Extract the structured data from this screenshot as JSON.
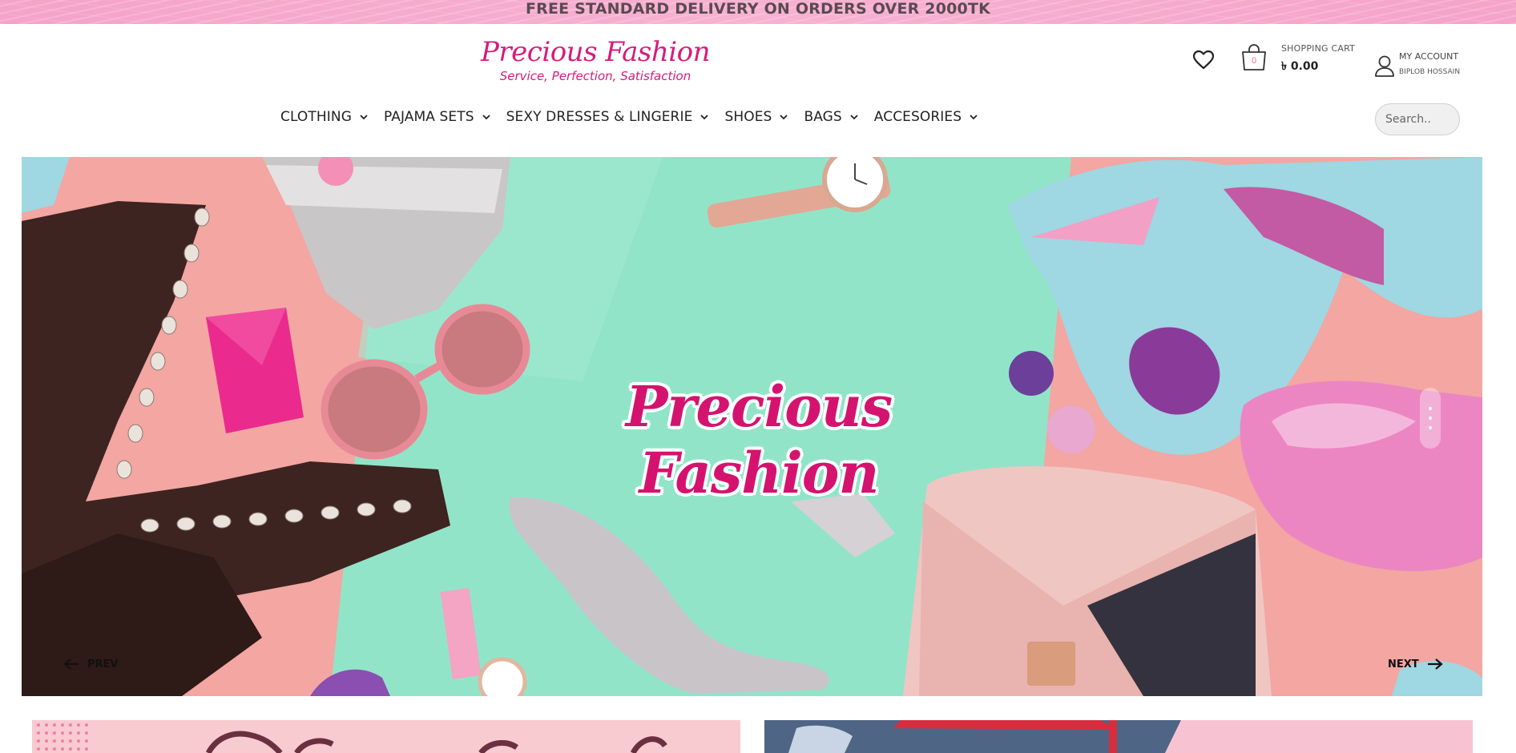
{
  "announcement": "FREE STANDARD DELIVERY ON ORDERS OVER 2000TK",
  "logo": {
    "title": "Precious Fashion",
    "tagline": "Service, Perfection, Satisfaction"
  },
  "header": {
    "wishlist_icon": "heart-icon",
    "cart": {
      "count": "0",
      "label": "SHOPPING CART",
      "amount": "৳ 0.00"
    },
    "account": {
      "label": "MY ACCOUNT",
      "user": "BIPLOB HOSSAIN"
    }
  },
  "nav": {
    "items": [
      {
        "label": "CLOTHING"
      },
      {
        "label": "PAJAMA SETS"
      },
      {
        "label": "SEXY DRESSES & LINGERIE"
      },
      {
        "label": "SHOES"
      },
      {
        "label": "BAGS"
      },
      {
        "label": "ACCESORIES"
      }
    ]
  },
  "search": {
    "placeholder": "Search.."
  },
  "hero": {
    "title": "Precious Fashion",
    "prev_label": "PREV",
    "next_label": "NEXT"
  },
  "colors": {
    "brand_pink": "#d81b7a",
    "topbar_pink": "#f7b1d1",
    "mint": "#8fe3c8",
    "salmon": "#f3a6a2"
  }
}
